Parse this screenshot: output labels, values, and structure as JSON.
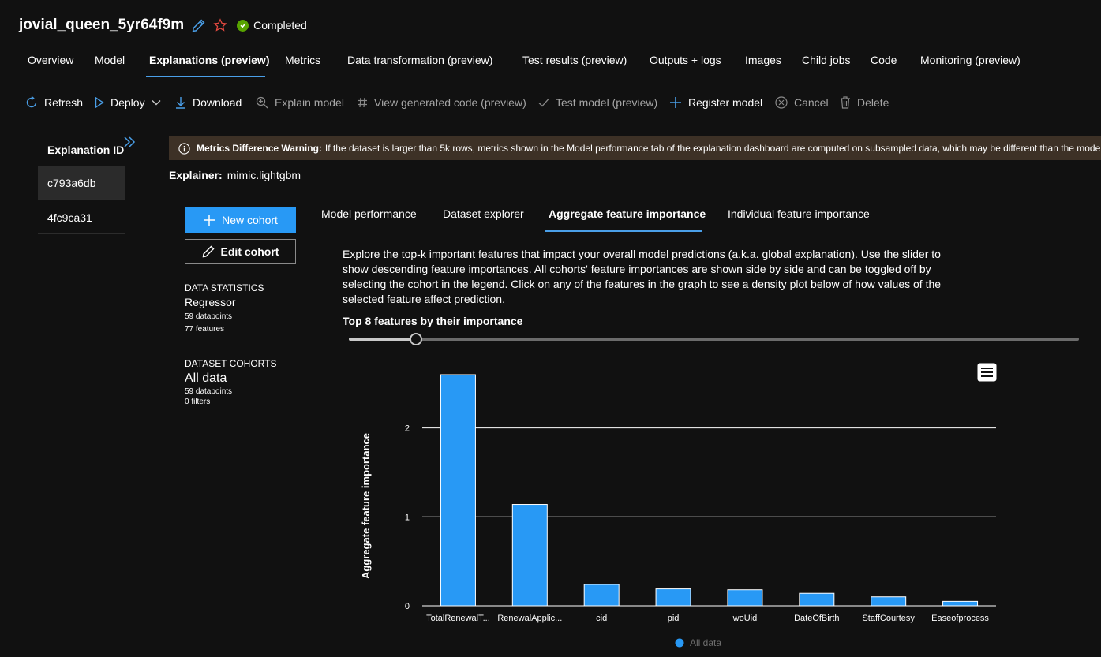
{
  "header": {
    "title": "jovial_queen_5yr64f9m",
    "status": "Completed"
  },
  "tabs": [
    {
      "label": "Overview",
      "active": false
    },
    {
      "label": "Model",
      "active": false
    },
    {
      "label": "Explanations (preview)",
      "active": true
    },
    {
      "label": "Metrics",
      "active": false
    },
    {
      "label": "Data transformation (preview)",
      "active": false
    },
    {
      "label": "Test results (preview)",
      "active": false
    },
    {
      "label": "Outputs + logs",
      "active": false
    },
    {
      "label": "Images",
      "active": false
    },
    {
      "label": "Child jobs",
      "active": false
    },
    {
      "label": "Code",
      "active": false
    },
    {
      "label": "Monitoring (preview)",
      "active": false
    }
  ],
  "toolbar": {
    "refresh": "Refresh",
    "deploy": "Deploy",
    "download": "Download",
    "explain": "Explain model",
    "view_code": "View generated code (preview)",
    "test_model": "Test model (preview)",
    "register": "Register model",
    "cancel": "Cancel",
    "delete": "Delete"
  },
  "explanations": {
    "header": "Explanation ID",
    "ids": [
      "c793a6db",
      "4fc9ca31"
    ],
    "selected": "c793a6db"
  },
  "warning": {
    "title": "Metrics Difference Warning:",
    "text": "If the dataset is larger than 5k rows, metrics shown in the Model performance tab of the explanation dashboard are computed on subsampled data, which may be different than the model"
  },
  "explainer": {
    "label": "Explainer:",
    "value": "mimic.lightgbm"
  },
  "cohort_buttons": {
    "new": "New cohort",
    "edit": "Edit cohort"
  },
  "data_statistics": {
    "caption": "DATA STATISTICS",
    "type": "Regressor",
    "datapoints": "59 datapoints",
    "features": "77 features"
  },
  "dataset_cohorts": {
    "caption": "DATASET COHORTS",
    "name": "All data",
    "datapoints": "59 datapoints",
    "filters": "0 filters"
  },
  "inner_tabs": [
    {
      "label": "Model performance",
      "active": false
    },
    {
      "label": "Dataset explorer",
      "active": false
    },
    {
      "label": "Aggregate feature importance",
      "active": true
    },
    {
      "label": "Individual feature importance",
      "active": false
    }
  ],
  "description": "Explore the top-k important features that impact your overall model predictions (a.k.a. global explanation). Use the slider to show descending feature importances. All cohorts' feature importances are shown side by side and can be toggled off by selecting the cohort in the legend. Click on any of the features in the graph to see a density plot below of how values of the selected feature affect prediction.",
  "slider": {
    "label": "Top 8 features by their importance",
    "value": 8,
    "min": 1,
    "max": 77
  },
  "colors": {
    "accent": "#2899f5",
    "bar": "#2899f5",
    "success": "#57a300",
    "star": "#e0483f"
  },
  "chart_data": {
    "type": "bar",
    "categories": [
      "TotalRenewalT...",
      "RenewalApplic...",
      "cid",
      "pid",
      "woUid",
      "DateOfBirth",
      "StaffCourtesy",
      "Easeofprocess"
    ],
    "series": [
      {
        "name": "All data",
        "values": [
          2.6,
          1.14,
          0.24,
          0.19,
          0.18,
          0.14,
          0.1,
          0.05
        ]
      }
    ],
    "ylabel": "Aggregate feature importance",
    "xlabel": "",
    "ylim": [
      0,
      2.6
    ],
    "yticks": [
      "0",
      "1",
      "2"
    ],
    "grid": true,
    "legend": "bottom"
  }
}
